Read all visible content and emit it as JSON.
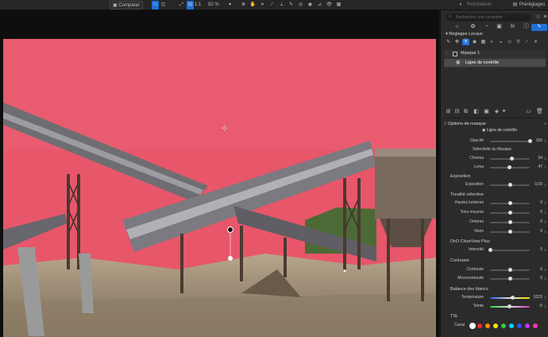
{
  "toolbar": {
    "compare": "Comparer",
    "ratio": "1:1",
    "zoom": "82 %",
    "restore": "Réinitialiser",
    "presets": "Préréglages"
  },
  "panel": {
    "search_placeholder": "Rechercher une correction",
    "section": "Réglages Locaux",
    "mask_name": "Masque 1",
    "layer_type": "Ligne de contrôle",
    "mask_options": "Options de masque",
    "tool_name": "Ligne de contrôle",
    "opacity_label": "Opacité",
    "opacity_value": "100",
    "opacity": 1.0,
    "selectivity_title": "Sélectivité du Masque",
    "chroma_label": "Chroma",
    "chroma_value": "54",
    "chroma": 0.54,
    "luma_label": "Luma",
    "luma_value": "47",
    "luma": 0.47,
    "exposure_title": "Exposition",
    "exposure_label": "Exposition",
    "exposure_value": "0,00",
    "exposure": 0.5,
    "tone_title": "Tonalité sélective",
    "highlights_label": "Hautes lumières",
    "highlights_value": "0",
    "midtones_label": "Tons moyens",
    "midtones_value": "0",
    "shadows_label": "Ombres",
    "shadows_value": "0",
    "blacks_label": "Noirs",
    "blacks_value": "0",
    "clearview_title": "DxO ClearView Plus",
    "intensity_label": "Intensité",
    "intensity_value": "0",
    "contrast_title": "Contraste",
    "contrast_label": "Contraste",
    "contrast_value": "0",
    "microcontrast_label": "Microcontraste",
    "microcontrast_value": "0",
    "wb_title": "Balance des blancs",
    "temperature_label": "Température",
    "temperature_value": "5223",
    "temperature": 0.55,
    "tint_label": "Teinte",
    "tint_value": "-5",
    "tint": 0.47,
    "hsl_title": "TSL",
    "channel_label": "Canal",
    "channel_colors": [
      "#ffffff",
      "#ff2a2a",
      "#ff8c00",
      "#f2e600",
      "#2ecc40",
      "#00d4ff",
      "#2f4bff",
      "#cc33ff",
      "#ff33aa"
    ]
  },
  "colors": {
    "mask_overlay": "#e8566a",
    "accent": "#1e6fd9"
  }
}
